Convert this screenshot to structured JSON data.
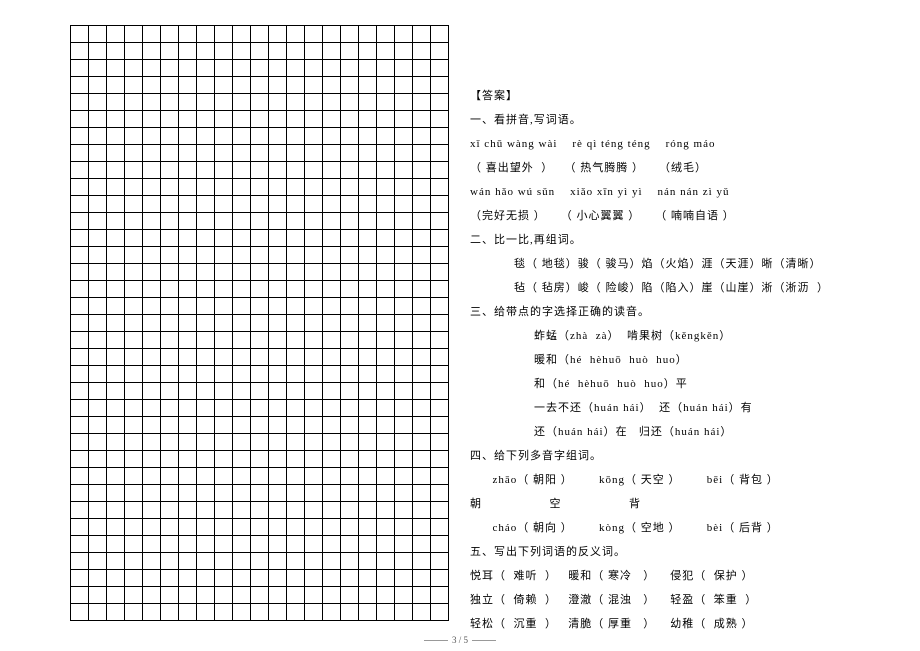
{
  "answers_heading": "【答案】",
  "sections": {
    "s1": {
      "title": "一、看拼音,写词语。",
      "line1": "xǐ chū wàng wài    rè qì téng téng    róng máo",
      "line2": "（ 喜出望外  ）   （ 热气腾腾 ）    （绒毛）",
      "line3": "wán hǎo wú sǔn    xiǎo xīn yì yì    nán nán zì yǔ",
      "line4": "（完好无损 ）    （ 小心翼翼 ）    （ 喃喃自语 ）"
    },
    "s2": {
      "title": "二、比一比,再组词。",
      "line1": "毯（ 地毯）骏（ 骏马）焰（火焰）涯（天涯）晰（清晰）",
      "line2": "毡（ 毡房）峻（ 险峻）陷（陷入）崖（山崖）淅（淅沥  ）"
    },
    "s3": {
      "title": "三、给带点的字选择正确的读音。",
      "line1": "蚱蜢（zhà  zà）  啃果树（kěngkěn）",
      "line2": "暖和（hé  hèhuō  huò  huo）",
      "line3": "和（hé  hèhuō  huò  huo）平",
      "line4": "一去不还（huán hái）  还（huán hái）有",
      "line5": "还（huán hái）在   归还（huán hái）"
    },
    "s4": {
      "title": "四、给下列多音字组词。",
      "line1": "      zhāo（ 朝阳 ）       kōng（ 天空 ）       bēi（ 背包 ）",
      "line2": "朝                  空                  背",
      "line3": "      cháo（ 朝向 ）       kòng（ 空地 ）       bèi（ 后背 ）"
    },
    "s5": {
      "title": "五、写出下列词语的反义词。",
      "line1": "悦耳（  难听  ）   暖和（ 寒冷   ）    侵犯（  保护 ）",
      "line2": "独立（  倚赖  ）   澄澈（ 混浊   ）    轻盈（  笨重  ）",
      "line3": "轻松（  沉重  ）   清脆（ 厚重   ）    幼稚（  成熟 ）"
    }
  },
  "footer_page": "3 / 5"
}
